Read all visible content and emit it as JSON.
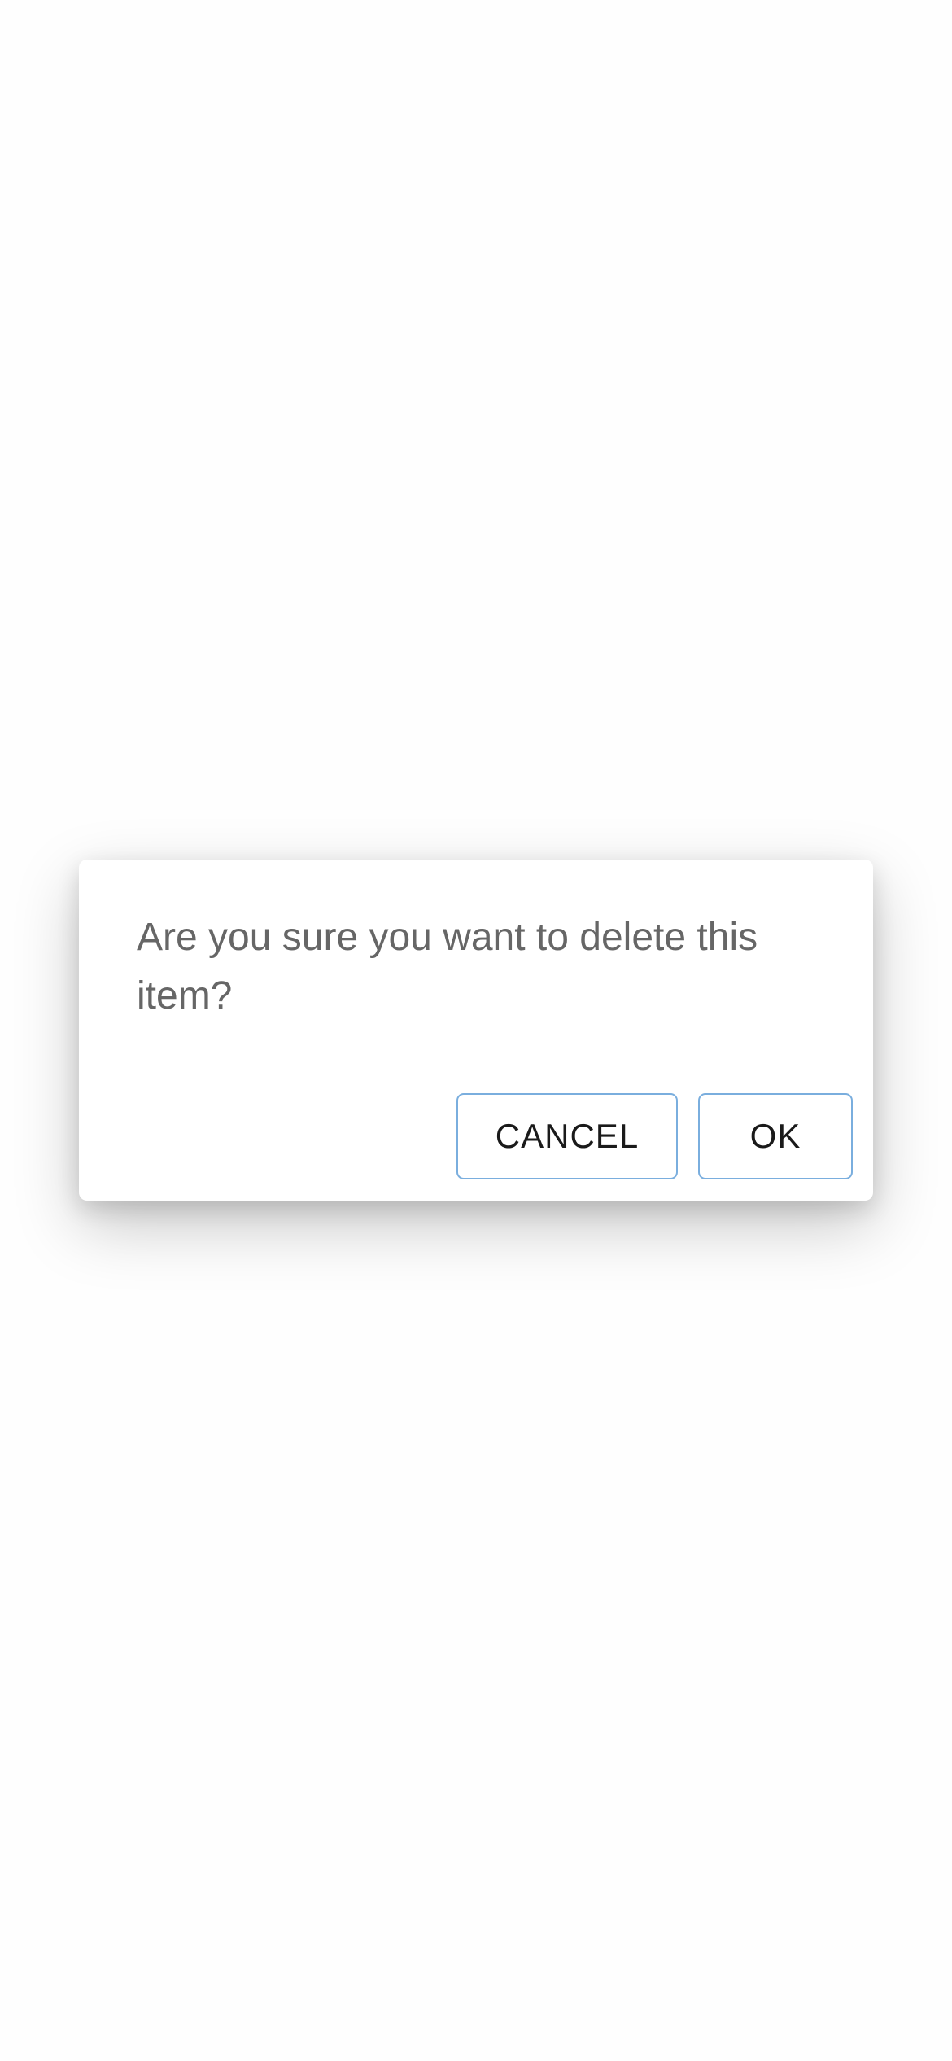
{
  "dialog": {
    "message": "Are you sure you want to delete this item?",
    "cancel_label": "CANCEL",
    "ok_label": "OK"
  },
  "colors": {
    "background": "#fefefe",
    "dialog_background": "#ffffff",
    "message_text": "#666666",
    "button_border": "#7aaede",
    "button_text": "#1a1a1a"
  }
}
